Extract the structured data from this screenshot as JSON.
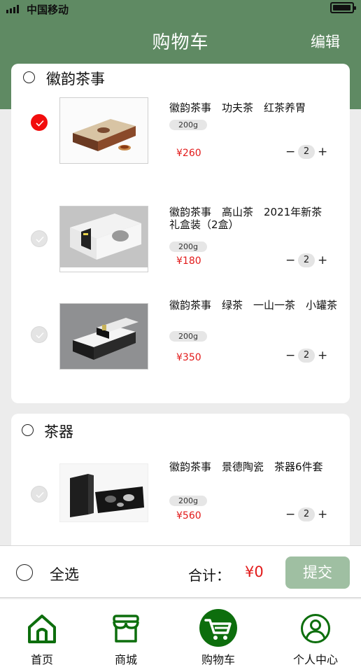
{
  "status_bar": {
    "carrier": "中国移动"
  },
  "header": {
    "title": "购物车",
    "edit_label": "编辑"
  },
  "shops": [
    {
      "name": "徽韵茶事",
      "items": [
        {
          "name": "徽韵茶事　功夫茶　红茶养胃",
          "spec": "200g",
          "price": "¥260",
          "quantity": "2",
          "checked": true
        },
        {
          "name": "徽韵茶事　高山茶　2021年新茶　礼盒装（2盒）",
          "spec": "200g",
          "price": "¥180",
          "quantity": "2",
          "checked": false
        },
        {
          "name": "徽韵茶事　绿茶　一山一茶　小罐茶",
          "spec": "200g",
          "price": "¥350",
          "quantity": "2",
          "checked": false
        }
      ]
    },
    {
      "name": "茶器",
      "items": [
        {
          "name": "徽韵茶事　景德陶瓷　茶器6件套",
          "spec": "200g",
          "price": "¥560",
          "quantity": "2",
          "checked": false
        }
      ]
    }
  ],
  "stepper": {
    "minus": "−",
    "plus": "+"
  },
  "checkout": {
    "select_all": "全选",
    "total_label": "合计：",
    "total_value": "¥0",
    "submit": "提交"
  },
  "tabbar": {
    "items": [
      {
        "label": "首页"
      },
      {
        "label": "商城"
      },
      {
        "label": "购物车"
      },
      {
        "label": "个人中心"
      }
    ],
    "active_index": 2
  },
  "colors": {
    "header_green": "#5f8a63",
    "tab_green": "#0d6e0d",
    "price_red": "#e21a1a",
    "submit_bg": "#9fbfa2"
  }
}
